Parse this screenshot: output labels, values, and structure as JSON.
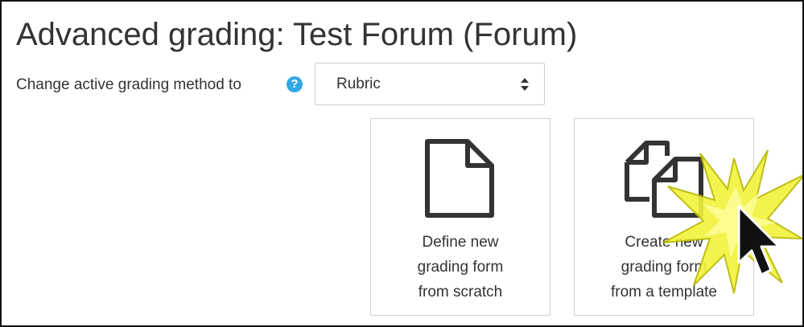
{
  "page": {
    "title": "Advanced grading: Test Forum (Forum)"
  },
  "method": {
    "label": "Change active grading method to",
    "help_icon": "?",
    "selected": "Rubric"
  },
  "options": [
    {
      "icon": "file-icon",
      "lines": [
        "Define new",
        "grading form",
        "from scratch"
      ]
    },
    {
      "icon": "copy-files-icon",
      "lines": [
        "Create new",
        "grading form",
        "from a template"
      ]
    }
  ],
  "colors": {
    "text": "#333333",
    "help_icon": "#31a8e6",
    "icon_stroke": "#333333",
    "highlight": "#f2f23a",
    "cursor": "#111111"
  }
}
